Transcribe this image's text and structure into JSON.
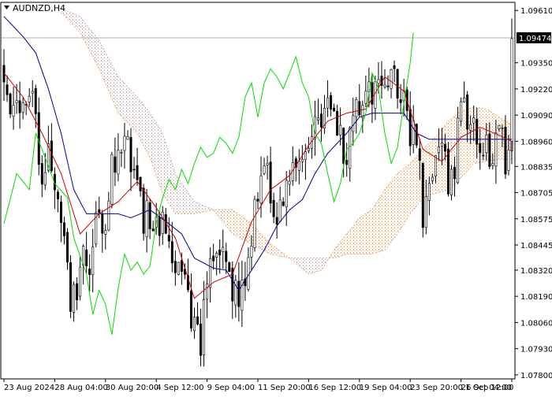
{
  "header": {
    "symbol_label": "AUDNZD,H4",
    "collapse_icon": "triangle-down-icon"
  },
  "colors": {
    "background": "#ffffff",
    "axis": "#000000",
    "candle": "#000000",
    "tenkan": "#cc0000",
    "kijun": "#00008b",
    "chikou": "#00dd00",
    "cloud_bull": "#f4a460",
    "cloud_bear": "#c9b0b0",
    "bid_line": "#b0b0b0",
    "bid_label_bg": "#000000",
    "bid_label_text": "#ffffff"
  },
  "chart_data": {
    "type": "candlestick",
    "symbol": "AUDNZD",
    "timeframe": "H4",
    "ylim": [
      1.0778,
      1.0965
    ],
    "y_ticks": [
      "1.09610",
      "1.09350",
      "1.09220",
      "1.09090",
      "1.08960",
      "1.08835",
      "1.08705",
      "1.08575",
      "1.08445",
      "1.08320",
      "1.08190",
      "1.08060",
      "1.07930",
      "1.07800"
    ],
    "current_price": "1.09474",
    "current_price_value": 1.09474,
    "x_tick_labels": [
      "23 Aug 2024",
      "28 Aug 04:00",
      "30 Aug 20:00",
      "4 Sep 12:00",
      "9 Sep 04:00",
      "11 Sep 20:00",
      "16 Sep 12:00",
      "19 Sep 04:00",
      "23 Sep 20:00",
      "26 Sep 12:00",
      "1 Oct 04:00"
    ],
    "x_tick_positions": [
      0,
      16,
      32,
      48,
      64,
      80,
      96,
      112,
      128,
      144,
      160
    ],
    "bar_count": 161,
    "price_waypoints": [
      [
        0,
        1.0932
      ],
      [
        3,
        1.091
      ],
      [
        6,
        1.0921
      ],
      [
        9,
        1.0913
      ],
      [
        12,
        1.088
      ],
      [
        14,
        1.089
      ],
      [
        17,
        1.087
      ],
      [
        19,
        1.0855
      ],
      [
        21,
        1.082
      ],
      [
        23,
        1.0812
      ],
      [
        25,
        1.084
      ],
      [
        27,
        1.0826
      ],
      [
        29,
        1.0862
      ],
      [
        32,
        1.0848
      ],
      [
        34,
        1.0882
      ],
      [
        36,
        1.0893
      ],
      [
        38,
        1.0897
      ],
      [
        40,
        1.0888
      ],
      [
        42,
        1.087
      ],
      [
        44,
        1.0856
      ],
      [
        46,
        1.086
      ],
      [
        48,
        1.085
      ],
      [
        50,
        1.0862
      ],
      [
        52,
        1.0847
      ],
      [
        54,
        1.0838
      ],
      [
        56,
        1.083
      ],
      [
        58,
        1.0814
      ],
      [
        60,
        1.0803
      ],
      [
        62,
        1.0792
      ],
      [
        64,
        1.0826
      ],
      [
        66,
        1.084
      ],
      [
        68,
        1.0845
      ],
      [
        70,
        1.0832
      ],
      [
        72,
        1.0816
      ],
      [
        74,
        1.082
      ],
      [
        76,
        1.0824
      ],
      [
        78,
        1.0852
      ],
      [
        80,
        1.0873
      ],
      [
        82,
        1.0882
      ],
      [
        84,
        1.0872
      ],
      [
        86,
        1.0862
      ],
      [
        88,
        1.0866
      ],
      [
        90,
        1.0881
      ],
      [
        92,
        1.0887
      ],
      [
        94,
        1.0892
      ],
      [
        96,
        1.0898
      ],
      [
        98,
        1.0904
      ],
      [
        100,
        1.091
      ],
      [
        102,
        1.0914
      ],
      [
        104,
        1.0906
      ],
      [
        106,
        1.0895
      ],
      [
        108,
        1.0888
      ],
      [
        110,
        1.09
      ],
      [
        112,
        1.0918
      ],
      [
        114,
        1.0924
      ],
      [
        116,
        1.0918
      ],
      [
        118,
        1.093
      ],
      [
        120,
        1.0926
      ],
      [
        122,
        1.0936
      ],
      [
        124,
        1.0922
      ],
      [
        126,
        1.0915
      ],
      [
        128,
        1.09
      ],
      [
        130,
        1.0898
      ],
      [
        132,
        1.0858
      ],
      [
        134,
        1.087
      ],
      [
        136,
        1.088
      ],
      [
        138,
        1.0892
      ],
      [
        140,
        1.0878
      ],
      [
        142,
        1.0886
      ],
      [
        144,
        1.0913
      ],
      [
        146,
        1.091
      ],
      [
        148,
        1.09
      ],
      [
        150,
        1.0898
      ],
      [
        152,
        1.0892
      ],
      [
        154,
        1.089
      ],
      [
        156,
        1.0902
      ],
      [
        158,
        1.0888
      ],
      [
        160,
        1.0897
      ]
    ],
    "tenkan_waypoints": [
      [
        0,
        1.093
      ],
      [
        6,
        1.0918
      ],
      [
        12,
        1.09
      ],
      [
        18,
        1.088
      ],
      [
        24,
        1.085
      ],
      [
        30,
        1.086
      ],
      [
        36,
        1.0866
      ],
      [
        42,
        1.0876
      ],
      [
        48,
        1.0863
      ],
      [
        54,
        1.0848
      ],
      [
        60,
        1.0818
      ],
      [
        66,
        1.0826
      ],
      [
        72,
        1.083
      ],
      [
        78,
        1.0856
      ],
      [
        84,
        1.0872
      ],
      [
        90,
        1.0879
      ],
      [
        96,
        1.0894
      ],
      [
        102,
        1.0906
      ],
      [
        108,
        1.091
      ],
      [
        114,
        1.0912
      ],
      [
        120,
        1.0928
      ],
      [
        126,
        1.0921
      ],
      [
        132,
        1.0892
      ],
      [
        138,
        1.0886
      ],
      [
        144,
        1.0898
      ],
      [
        150,
        1.0903
      ],
      [
        156,
        1.0899
      ],
      [
        160,
        1.0896
      ]
    ],
    "kijun_waypoints": [
      [
        0,
        1.0958
      ],
      [
        6,
        1.0948
      ],
      [
        10,
        1.094
      ],
      [
        14,
        1.0922
      ],
      [
        18,
        1.09
      ],
      [
        22,
        1.0872
      ],
      [
        26,
        1.086
      ],
      [
        30,
        1.086
      ],
      [
        36,
        1.086
      ],
      [
        40,
        1.0858
      ],
      [
        46,
        1.0862
      ],
      [
        52,
        1.0855
      ],
      [
        56,
        1.085
      ],
      [
        60,
        1.0838
      ],
      [
        66,
        1.0833
      ],
      [
        70,
        1.0832
      ],
      [
        74,
        1.0822
      ],
      [
        78,
        1.0832
      ],
      [
        82,
        1.0842
      ],
      [
        86,
        1.0854
      ],
      [
        90,
        1.0862
      ],
      [
        94,
        1.0867
      ],
      [
        98,
        1.088
      ],
      [
        102,
        1.089
      ],
      [
        108,
        1.09
      ],
      [
        112,
        1.0908
      ],
      [
        116,
        1.091
      ],
      [
        120,
        1.091
      ],
      [
        126,
        1.091
      ],
      [
        130,
        1.09
      ],
      [
        134,
        1.0897
      ],
      [
        138,
        1.0897
      ],
      [
        142,
        1.0897
      ],
      [
        150,
        1.0897
      ],
      [
        160,
        1.0897
      ]
    ],
    "chikou_waypoints": [
      [
        0,
        1.0855
      ],
      [
        4,
        1.088
      ],
      [
        8,
        1.0872
      ],
      [
        10,
        1.09
      ],
      [
        12,
        1.0892
      ],
      [
        16,
        1.0875
      ],
      [
        20,
        1.0868
      ],
      [
        22,
        1.0848
      ],
      [
        26,
        1.083
      ],
      [
        28,
        1.081
      ],
      [
        30,
        1.0822
      ],
      [
        32,
        1.0815
      ],
      [
        34,
        1.08
      ],
      [
        36,
        1.0823
      ],
      [
        38,
        1.084
      ],
      [
        40,
        1.0832
      ],
      [
        42,
        1.0836
      ],
      [
        44,
        1.083
      ],
      [
        46,
        1.0834
      ],
      [
        48,
        1.0856
      ],
      [
        50,
        1.0868
      ],
      [
        52,
        1.0877
      ],
      [
        54,
        1.0872
      ],
      [
        56,
        1.0882
      ],
      [
        58,
        1.0875
      ],
      [
        60,
        1.0885
      ],
      [
        62,
        1.0893
      ],
      [
        64,
        1.0888
      ],
      [
        66,
        1.089
      ],
      [
        68,
        1.0898
      ],
      [
        70,
        1.0895
      ],
      [
        72,
        1.089
      ],
      [
        74,
        1.0898
      ],
      [
        76,
        1.0918
      ],
      [
        78,
        1.0925
      ],
      [
        80,
        1.0908
      ],
      [
        82,
        1.0925
      ],
      [
        84,
        1.0932
      ],
      [
        86,
        1.0928
      ],
      [
        88,
        1.0922
      ],
      [
        90,
        1.093
      ],
      [
        92,
        1.0938
      ],
      [
        94,
        1.0925
      ],
      [
        96,
        1.0918
      ],
      [
        98,
        1.09
      ],
      [
        100,
        1.0895
      ],
      [
        102,
        1.088
      ],
      [
        104,
        1.0866
      ],
      [
        106,
        1.0875
      ],
      [
        108,
        1.0892
      ],
      [
        110,
        1.0895
      ],
      [
        112,
        1.09
      ],
      [
        114,
        1.091
      ],
      [
        116,
        1.093
      ],
      [
        118,
        1.0922
      ],
      [
        120,
        1.09
      ],
      [
        122,
        1.0885
      ],
      [
        124,
        1.0893
      ],
      [
        126,
        1.0915
      ],
      [
        128,
        1.0935
      ],
      [
        129,
        1.095
      ]
    ],
    "senkou_a_waypoints": [
      [
        18,
        1.096
      ],
      [
        24,
        1.095
      ],
      [
        30,
        1.0932
      ],
      [
        36,
        1.091
      ],
      [
        42,
        1.09
      ],
      [
        46,
        1.0888
      ],
      [
        50,
        1.087
      ],
      [
        54,
        1.086
      ],
      [
        60,
        1.086
      ],
      [
        66,
        1.0862
      ],
      [
        72,
        1.0862
      ],
      [
        78,
        1.0855
      ],
      [
        84,
        1.0845
      ],
      [
        90,
        1.0838
      ],
      [
        96,
        1.083
      ],
      [
        100,
        1.0832
      ],
      [
        104,
        1.0842
      ],
      [
        108,
        1.085
      ],
      [
        112,
        1.0858
      ],
      [
        116,
        1.0862
      ],
      [
        120,
        1.0872
      ],
      [
        124,
        1.088
      ],
      [
        128,
        1.0885
      ],
      [
        132,
        1.0892
      ],
      [
        136,
        1.0898
      ],
      [
        140,
        1.0906
      ],
      [
        144,
        1.0911
      ],
      [
        148,
        1.0913
      ],
      [
        152,
        1.0912
      ],
      [
        156,
        1.0908
      ],
      [
        160,
        1.0904
      ]
    ],
    "senkou_b_waypoints": [
      [
        18,
        1.0962
      ],
      [
        24,
        1.0958
      ],
      [
        30,
        1.0946
      ],
      [
        36,
        1.0928
      ],
      [
        42,
        1.0918
      ],
      [
        46,
        1.091
      ],
      [
        50,
        1.09
      ],
      [
        54,
        1.088
      ],
      [
        60,
        1.0866
      ],
      [
        66,
        1.0862
      ],
      [
        72,
        1.085
      ],
      [
        78,
        1.0845
      ],
      [
        84,
        1.084
      ],
      [
        90,
        1.0838
      ],
      [
        96,
        1.0838
      ],
      [
        100,
        1.0838
      ],
      [
        104,
        1.0838
      ],
      [
        108,
        1.084
      ],
      [
        112,
        1.084
      ],
      [
        116,
        1.084
      ],
      [
        120,
        1.0842
      ],
      [
        124,
        1.085
      ],
      [
        128,
        1.086
      ],
      [
        132,
        1.0868
      ],
      [
        136,
        1.087
      ],
      [
        140,
        1.0872
      ],
      [
        144,
        1.0878
      ],
      [
        148,
        1.0885
      ],
      [
        152,
        1.0886
      ],
      [
        156,
        1.0887
      ],
      [
        160,
        1.0887
      ]
    ]
  }
}
